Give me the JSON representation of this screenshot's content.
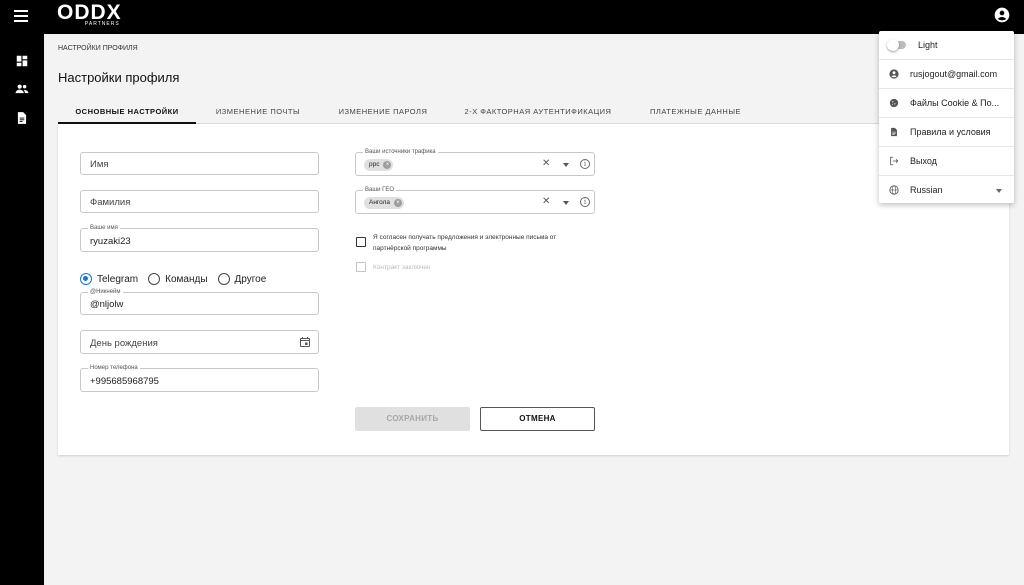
{
  "header": {
    "logo_main": "ODDX",
    "logo_sub": "PARTNERS"
  },
  "breadcrumb": "НАСТРОЙКИ ПРОФИЛЯ",
  "page_title": "Настройки профиля",
  "tabs": [
    {
      "label": "ОСНОВНЫЕ НАСТРОЙКИ",
      "active": true
    },
    {
      "label": "ИЗМЕНЕНИЕ ПОЧТЫ",
      "active": false
    },
    {
      "label": "ИЗМЕНЕНИЕ ПАРОЛЯ",
      "active": false
    },
    {
      "label": "2-Х ФАКТОРНАЯ АУТЕНТИФИКАЦИЯ",
      "active": false
    },
    {
      "label": "ПЛАТЕЖНЫЕ ДАННЫЕ",
      "active": false
    }
  ],
  "form": {
    "first_name_placeholder": "Имя",
    "last_name_placeholder": "Фамилия",
    "your_name_label": "Ваше имя",
    "your_name_value": "ryuzaki23",
    "contact_options": [
      {
        "label": "Telegram",
        "selected": true
      },
      {
        "label": "Команды",
        "selected": false
      },
      {
        "label": "Другое",
        "selected": false
      }
    ],
    "nickname_label": "@Никнейм",
    "nickname_value": "@nljolw",
    "birthday_placeholder": "День рождения",
    "phone_label": "Номер телефона",
    "phone_value": "+995685968795",
    "traffic_label": "Ваши источники трафика",
    "traffic_chip": "ppc",
    "geo_label": "Ваши ГЕО",
    "geo_chip": "Ангола",
    "consent_text_line1": "Я согласен получать предложения и электронные письма от",
    "consent_text_line2": "партнёрской программы",
    "contract_text": "Контракт заключен",
    "save_label": "СОХРАНИТЬ",
    "cancel_label": "ОТМЕНА"
  },
  "account_menu": {
    "theme_label": "Light",
    "email": "rusjogout@gmail.com",
    "cookies": "Файлы Cookie & По...",
    "terms": "Правила и условия",
    "logout": "Выход",
    "language": "Russian"
  },
  "colors": {
    "accent": "#1976d2",
    "topbar": "#000000",
    "background": "#f3f3f3"
  }
}
